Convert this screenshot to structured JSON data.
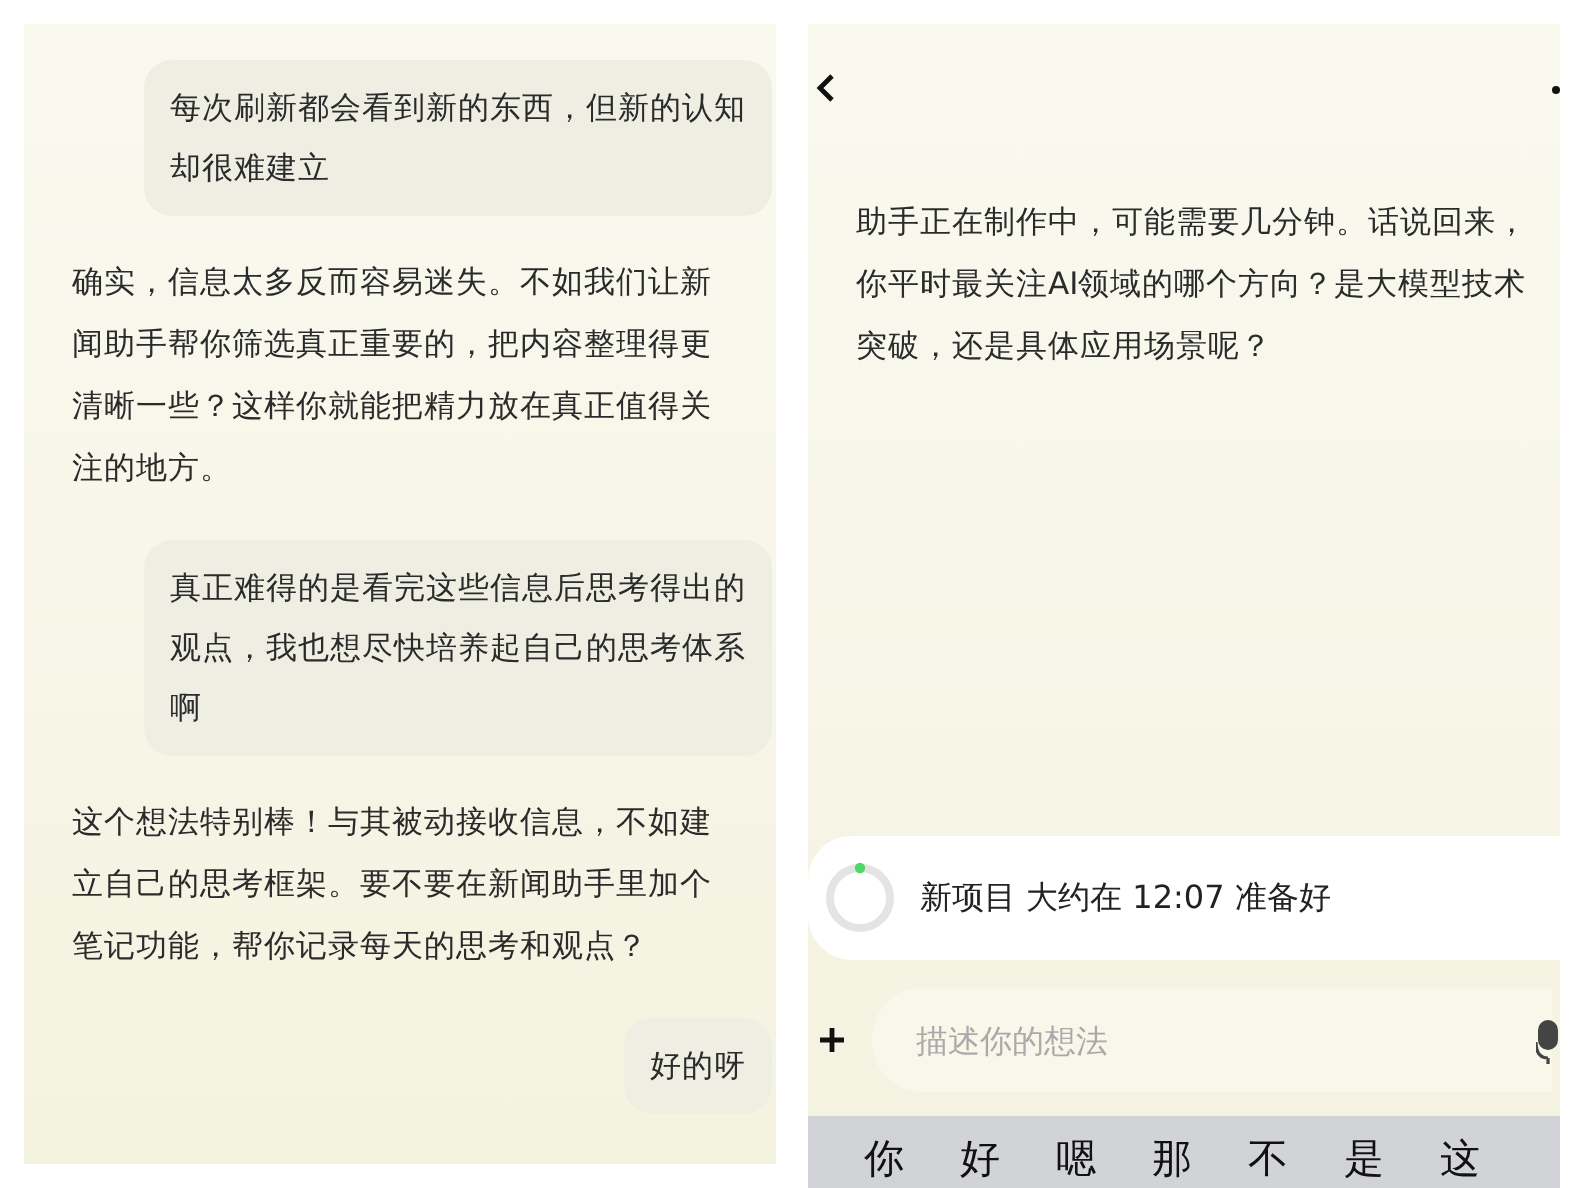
{
  "left_chat": {
    "messages": [
      {
        "kind": "user",
        "text": "每次刷新都会看到新的东西，但新的认知却很难建立"
      },
      {
        "kind": "assistant",
        "text": "确实，信息太多反而容易迷失。不如我们让新闻助手帮你筛选真正重要的，把内容整理得更清晰一些？这样你就能把精力放在真正值得关注的地方。"
      },
      {
        "kind": "user",
        "text": "真正难得的是看完这些信息后思考得出的观点，我也想尽快培养起自己的思考体系啊"
      },
      {
        "kind": "assistant",
        "text": "这个想法特别棒！与其被动接收信息，不如建立自己的思考框架。要不要在新闻助手里加个笔记功能，帮你记录每天的思考和观点？"
      },
      {
        "kind": "user",
        "text": "好的呀"
      }
    ]
  },
  "right_chat": {
    "messages": [
      {
        "kind": "assistant",
        "text": "助手正在制作中，可能需要几分钟。话说回来，你平时最关注AI领域的哪个方向？是大模型技术突破，还是具体应用场景呢？"
      }
    ],
    "status": {
      "text": "新项目 大约在 12:07 准备好"
    },
    "composer": {
      "placeholder": "描述你的想法"
    },
    "keyboard_candidates": [
      "你",
      "好",
      "嗯",
      "那",
      "不",
      "是",
      "这"
    ]
  }
}
